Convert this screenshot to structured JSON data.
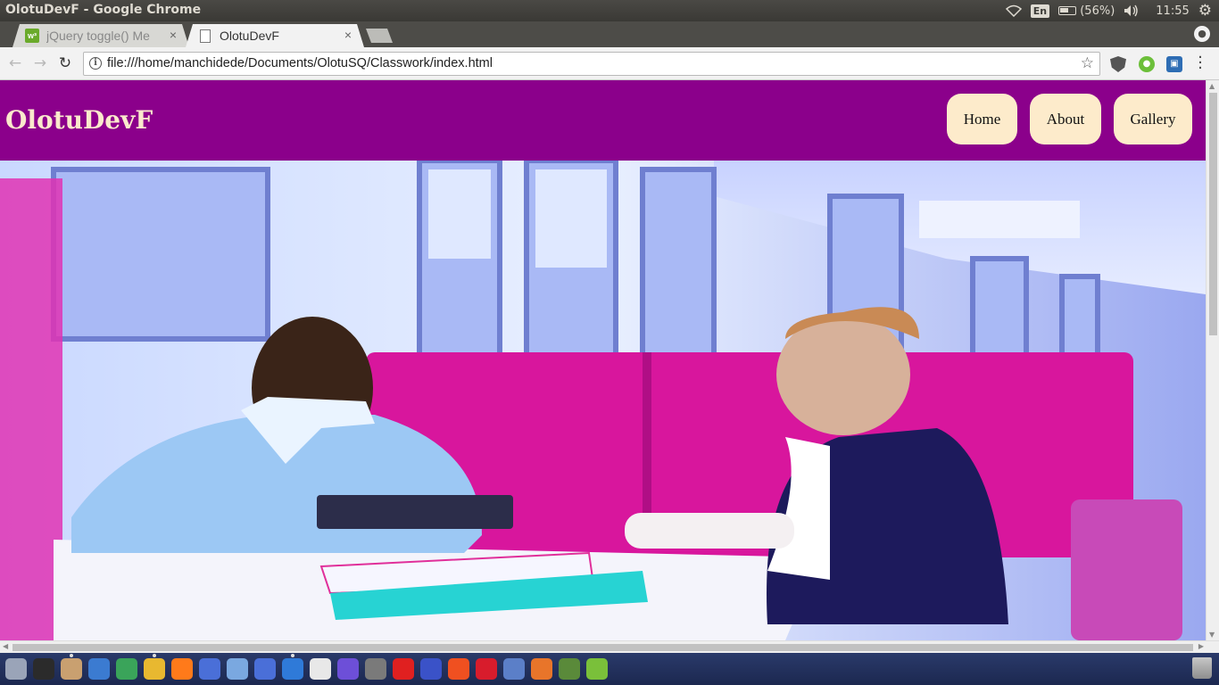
{
  "os_panel": {
    "window_title": "OlotuDevF - Google Chrome",
    "keyboard_layout": "En",
    "battery": "(56%)",
    "time": "11:55"
  },
  "browser": {
    "tabs": [
      {
        "label": "jQuery toggle() Me",
        "active": false
      },
      {
        "label": "OlotuDevF",
        "active": true
      }
    ],
    "close_glyph": "×",
    "url": "file:///home/manchidede/Documents/OlotuSQ/Classwork/index.html"
  },
  "site": {
    "title": "OlotuDevF",
    "nav": [
      "Home",
      "About",
      "Gallery"
    ],
    "colors": {
      "header_bg": "#8b008b",
      "nav_bg": "#fdebcb",
      "title_color": "#fae9cc"
    }
  },
  "launcher": {
    "icons": [
      "dash-home-icon",
      "terminal-icon",
      "files-icon",
      "writer-icon",
      "calc-icon",
      "chrome-icon",
      "firefox-icon",
      "app-icon",
      "chromium-icon",
      "app-icon",
      "vscode-icon",
      "text-editor-icon",
      "firefox-dev-icon",
      "app-icon",
      "yandex-icon",
      "firefox-nightly-icon",
      "brave-icon",
      "opera-icon",
      "web-icon",
      "software-center-icon",
      "app-icon",
      "app-icon"
    ]
  }
}
